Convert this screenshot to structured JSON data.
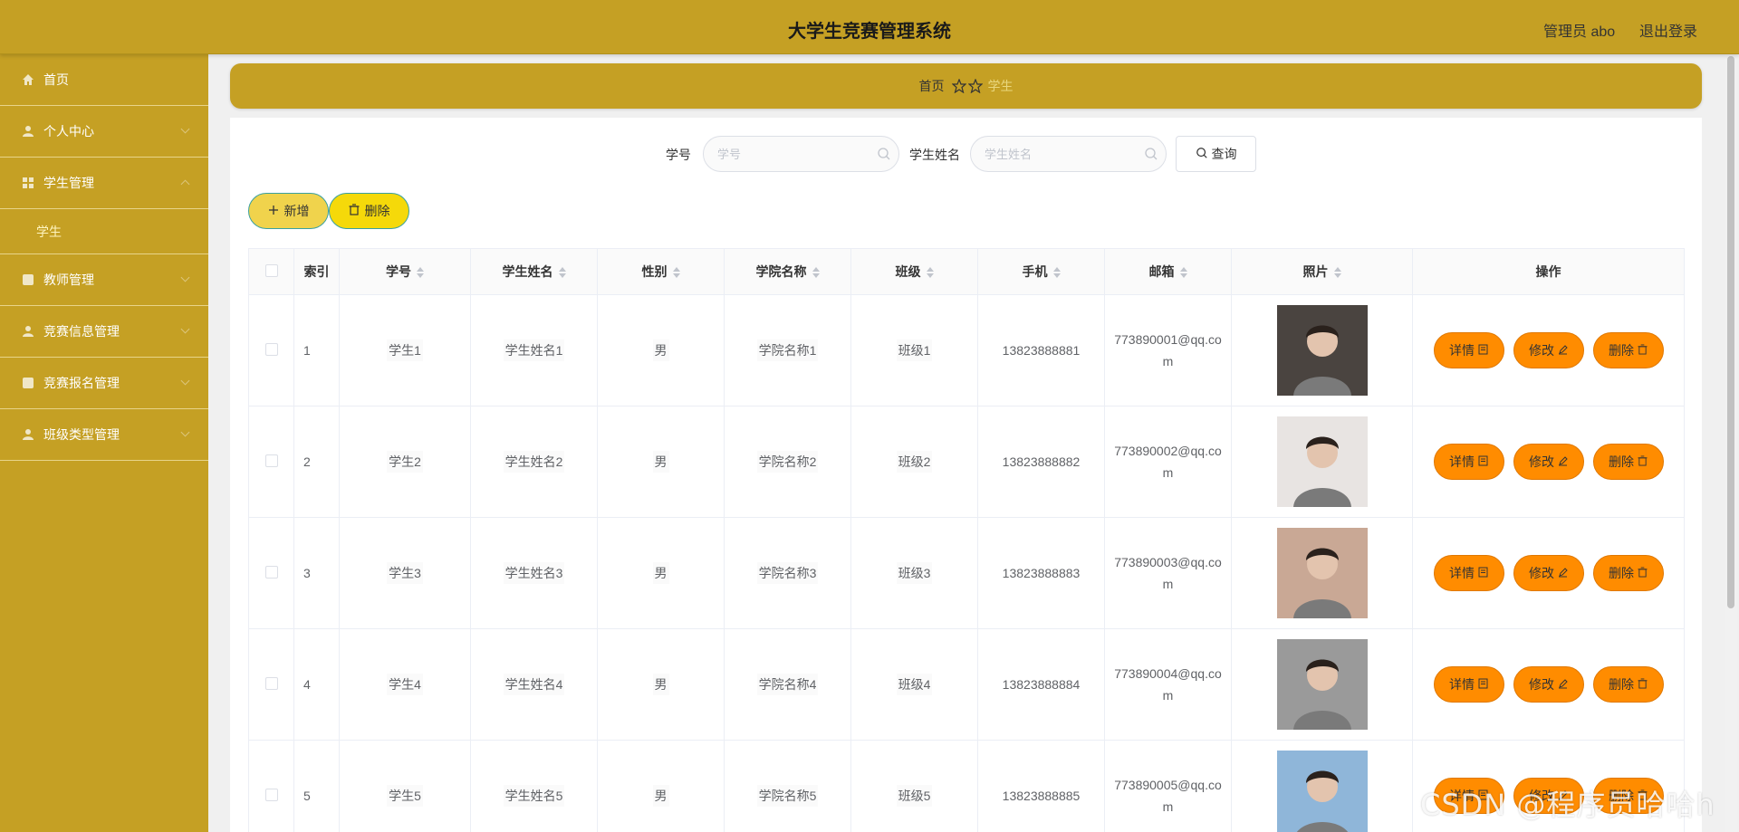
{
  "header": {
    "title": "大学生竞赛管理系统",
    "user_label": "管理员 abo",
    "logout_label": "退出登录"
  },
  "sidebar": {
    "items": [
      {
        "label": "首页",
        "icon": "home-icon"
      },
      {
        "label": "个人中心",
        "icon": "user-icon"
      },
      {
        "label": "学生管理",
        "icon": "grid-icon"
      },
      {
        "label": "教师管理",
        "icon": "grid-icon"
      },
      {
        "label": "竞赛信息管理",
        "icon": "user-icon"
      },
      {
        "label": "竞赛报名管理",
        "icon": "grid-icon"
      },
      {
        "label": "班级类型管理",
        "icon": "user-icon"
      }
    ],
    "subitem": "学生"
  },
  "breadcrumb": {
    "home": "首页",
    "current": "学生"
  },
  "search": {
    "field1_label": "学号",
    "field1_placeholder": "学号",
    "field2_label": "学生姓名",
    "field2_placeholder": "学生姓名",
    "query_label": "查询"
  },
  "actions": {
    "add_label": "新增",
    "delete_label": "删除"
  },
  "table": {
    "headers": [
      "索引",
      "学号",
      "学生姓名",
      "性别",
      "学院名称",
      "班级",
      "手机",
      "邮箱",
      "照片",
      "操作"
    ],
    "rows": [
      {
        "index": "1",
        "id": "学生1",
        "name": "学生姓名1",
        "gender": "男",
        "college": "学院名称1",
        "class": "班级1",
        "phone": "13823888881",
        "email": "773890001@qq.com",
        "photo_bg": "#4a4440"
      },
      {
        "index": "2",
        "id": "学生2",
        "name": "学生姓名2",
        "gender": "男",
        "college": "学院名称2",
        "class": "班级2",
        "phone": "13823888882",
        "email": "773890002@qq.com",
        "photo_bg": "#e8e4e2"
      },
      {
        "index": "3",
        "id": "学生3",
        "name": "学生姓名3",
        "gender": "男",
        "college": "学院名称3",
        "class": "班级3",
        "phone": "13823888883",
        "email": "773890003@qq.com",
        "photo_bg": "#c9a895"
      },
      {
        "index": "4",
        "id": "学生4",
        "name": "学生姓名4",
        "gender": "男",
        "college": "学院名称4",
        "class": "班级4",
        "phone": "13823888884",
        "email": "773890004@qq.com",
        "photo_bg": "#9a9a9a"
      },
      {
        "index": "5",
        "id": "学生5",
        "name": "学生姓名5",
        "gender": "男",
        "college": "学院名称5",
        "class": "班级5",
        "phone": "13823888885",
        "email": "773890005@qq.com",
        "photo_bg": "#8fb6d9"
      }
    ],
    "op_detail": "详情",
    "op_edit": "修改",
    "op_delete": "删除"
  },
  "watermark": "CSDN @程序员哈哈h",
  "colors": {
    "primary": "#c5a024",
    "action": "#ff8c00",
    "add_button": "#f0d34c",
    "delete_button": "#f5d90a"
  }
}
